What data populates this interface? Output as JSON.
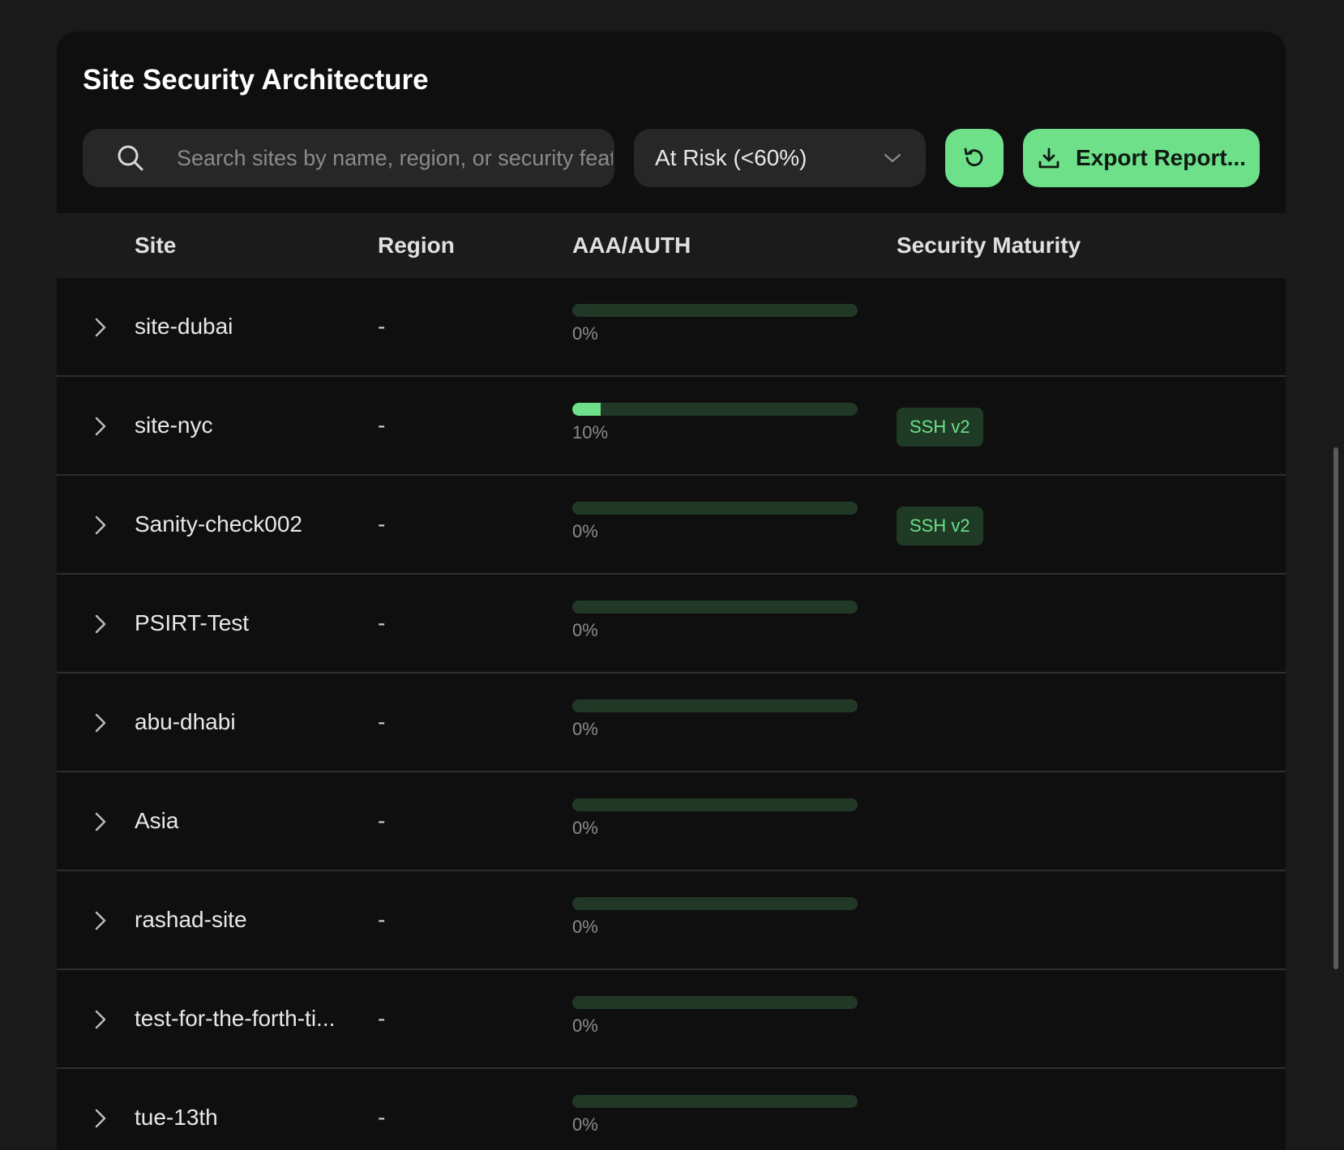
{
  "page": {
    "title": "Site Security Architecture"
  },
  "toolbar": {
    "search_placeholder": "Search sites by name, region, or security feature...",
    "filter_value": "At Risk (<60%)",
    "export_label": "Export Report..."
  },
  "table": {
    "headers": {
      "site": "Site",
      "region": "Region",
      "aaa": "AAA/AUTH",
      "maturity": "Security Maturity"
    },
    "rows": [
      {
        "site": "site-dubai",
        "region": "-",
        "aaa_pct": 0,
        "aaa_label": "0%",
        "badges": []
      },
      {
        "site": "site-nyc",
        "region": "-",
        "aaa_pct": 10,
        "aaa_label": "10%",
        "badges": [
          "SSH v2"
        ]
      },
      {
        "site": "Sanity-check002",
        "region": "-",
        "aaa_pct": 0,
        "aaa_label": "0%",
        "badges": [
          "SSH v2"
        ]
      },
      {
        "site": "PSIRT-Test",
        "region": "-",
        "aaa_pct": 0,
        "aaa_label": "0%",
        "badges": []
      },
      {
        "site": "abu-dhabi",
        "region": "-",
        "aaa_pct": 0,
        "aaa_label": "0%",
        "badges": []
      },
      {
        "site": "Asia",
        "region": "-",
        "aaa_pct": 0,
        "aaa_label": "0%",
        "badges": []
      },
      {
        "site": "rashad-site",
        "region": "-",
        "aaa_pct": 0,
        "aaa_label": "0%",
        "badges": []
      },
      {
        "site": "test-for-the-forth-ti...",
        "region": "-",
        "aaa_pct": 0,
        "aaa_label": "0%",
        "badges": []
      },
      {
        "site": "tue-13th",
        "region": "-",
        "aaa_pct": 0,
        "aaa_label": "0%",
        "badges": []
      }
    ]
  },
  "icons": {
    "search": "search-icon",
    "filter": "chevron-down-icon",
    "refresh": "refresh-icon",
    "export": "download-icon",
    "row": "chevron-right-icon"
  },
  "colors": {
    "accent": "#6ee08a",
    "badge_bg": "#1f3a25",
    "bar_track": "#223826",
    "card_bg": "#0f0f0f",
    "page_bg": "#1a1a1a"
  }
}
